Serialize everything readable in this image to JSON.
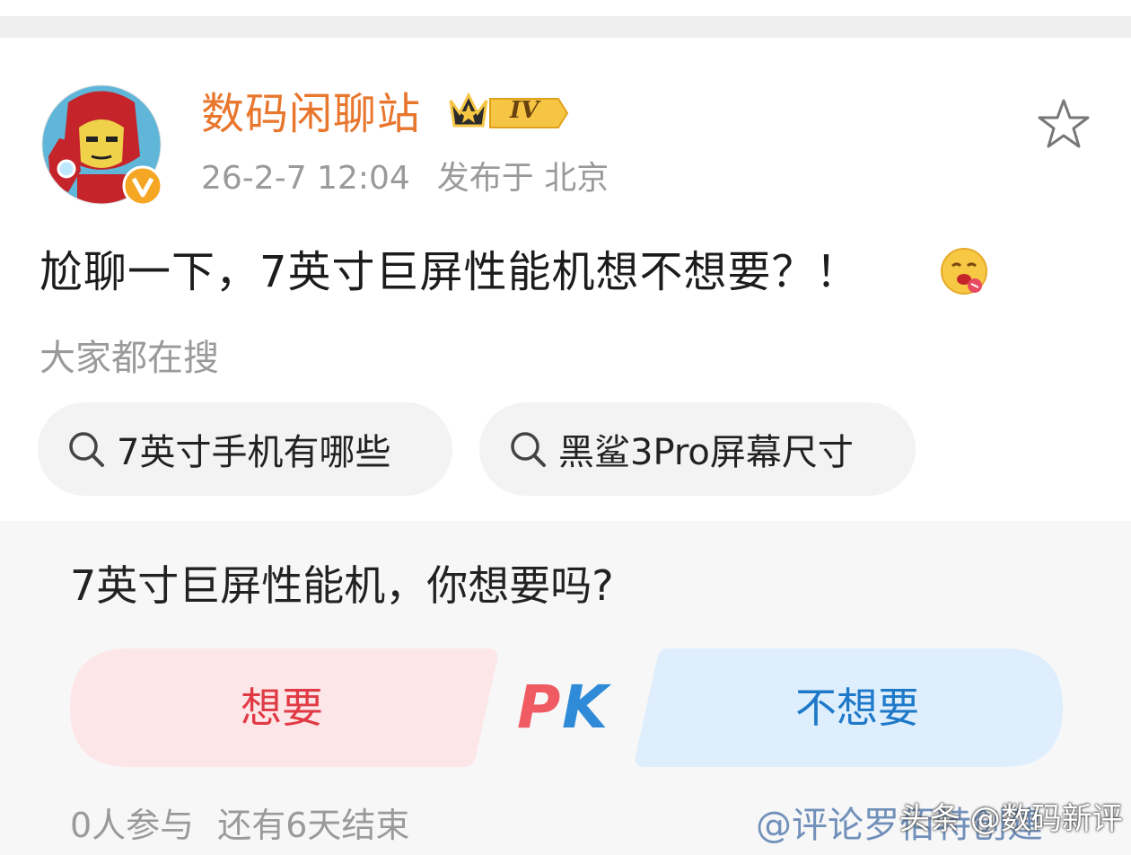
{
  "post": {
    "author": "数码闲聊站",
    "vip_level": "IV",
    "timestamp": "26-2-7 12:04",
    "location": "发布于 北京",
    "text": "尬聊一下，7英寸巨屏性能机想不想要？！"
  },
  "search": {
    "title": "大家都在搜",
    "chips": [
      {
        "label": "7英寸手机有哪些"
      },
      {
        "label": "黑鲨3Pro屏幕尺寸"
      }
    ]
  },
  "poll": {
    "question": "7英寸巨屏性能机，你想要吗?",
    "option_yes": "想要",
    "vs_label": "PK",
    "option_no": "不想要",
    "participants": "0人参与",
    "remaining": "还有6天结束",
    "creator": "@评论罗佰特创建"
  },
  "watermark": "头条 @数码新评",
  "colors": {
    "author": "#e8762d",
    "yes_bg": "#fde6e8",
    "yes_text": "#e03b45",
    "no_bg": "#deeefc",
    "no_text": "#1f79c9",
    "muted": "#9a9a9a"
  },
  "icons": {
    "favorite": "star-outline-icon",
    "search": "search-icon",
    "verified": "verified-v-icon",
    "vip": "crown-icon",
    "emoji": "drooling-emoji-icon"
  }
}
